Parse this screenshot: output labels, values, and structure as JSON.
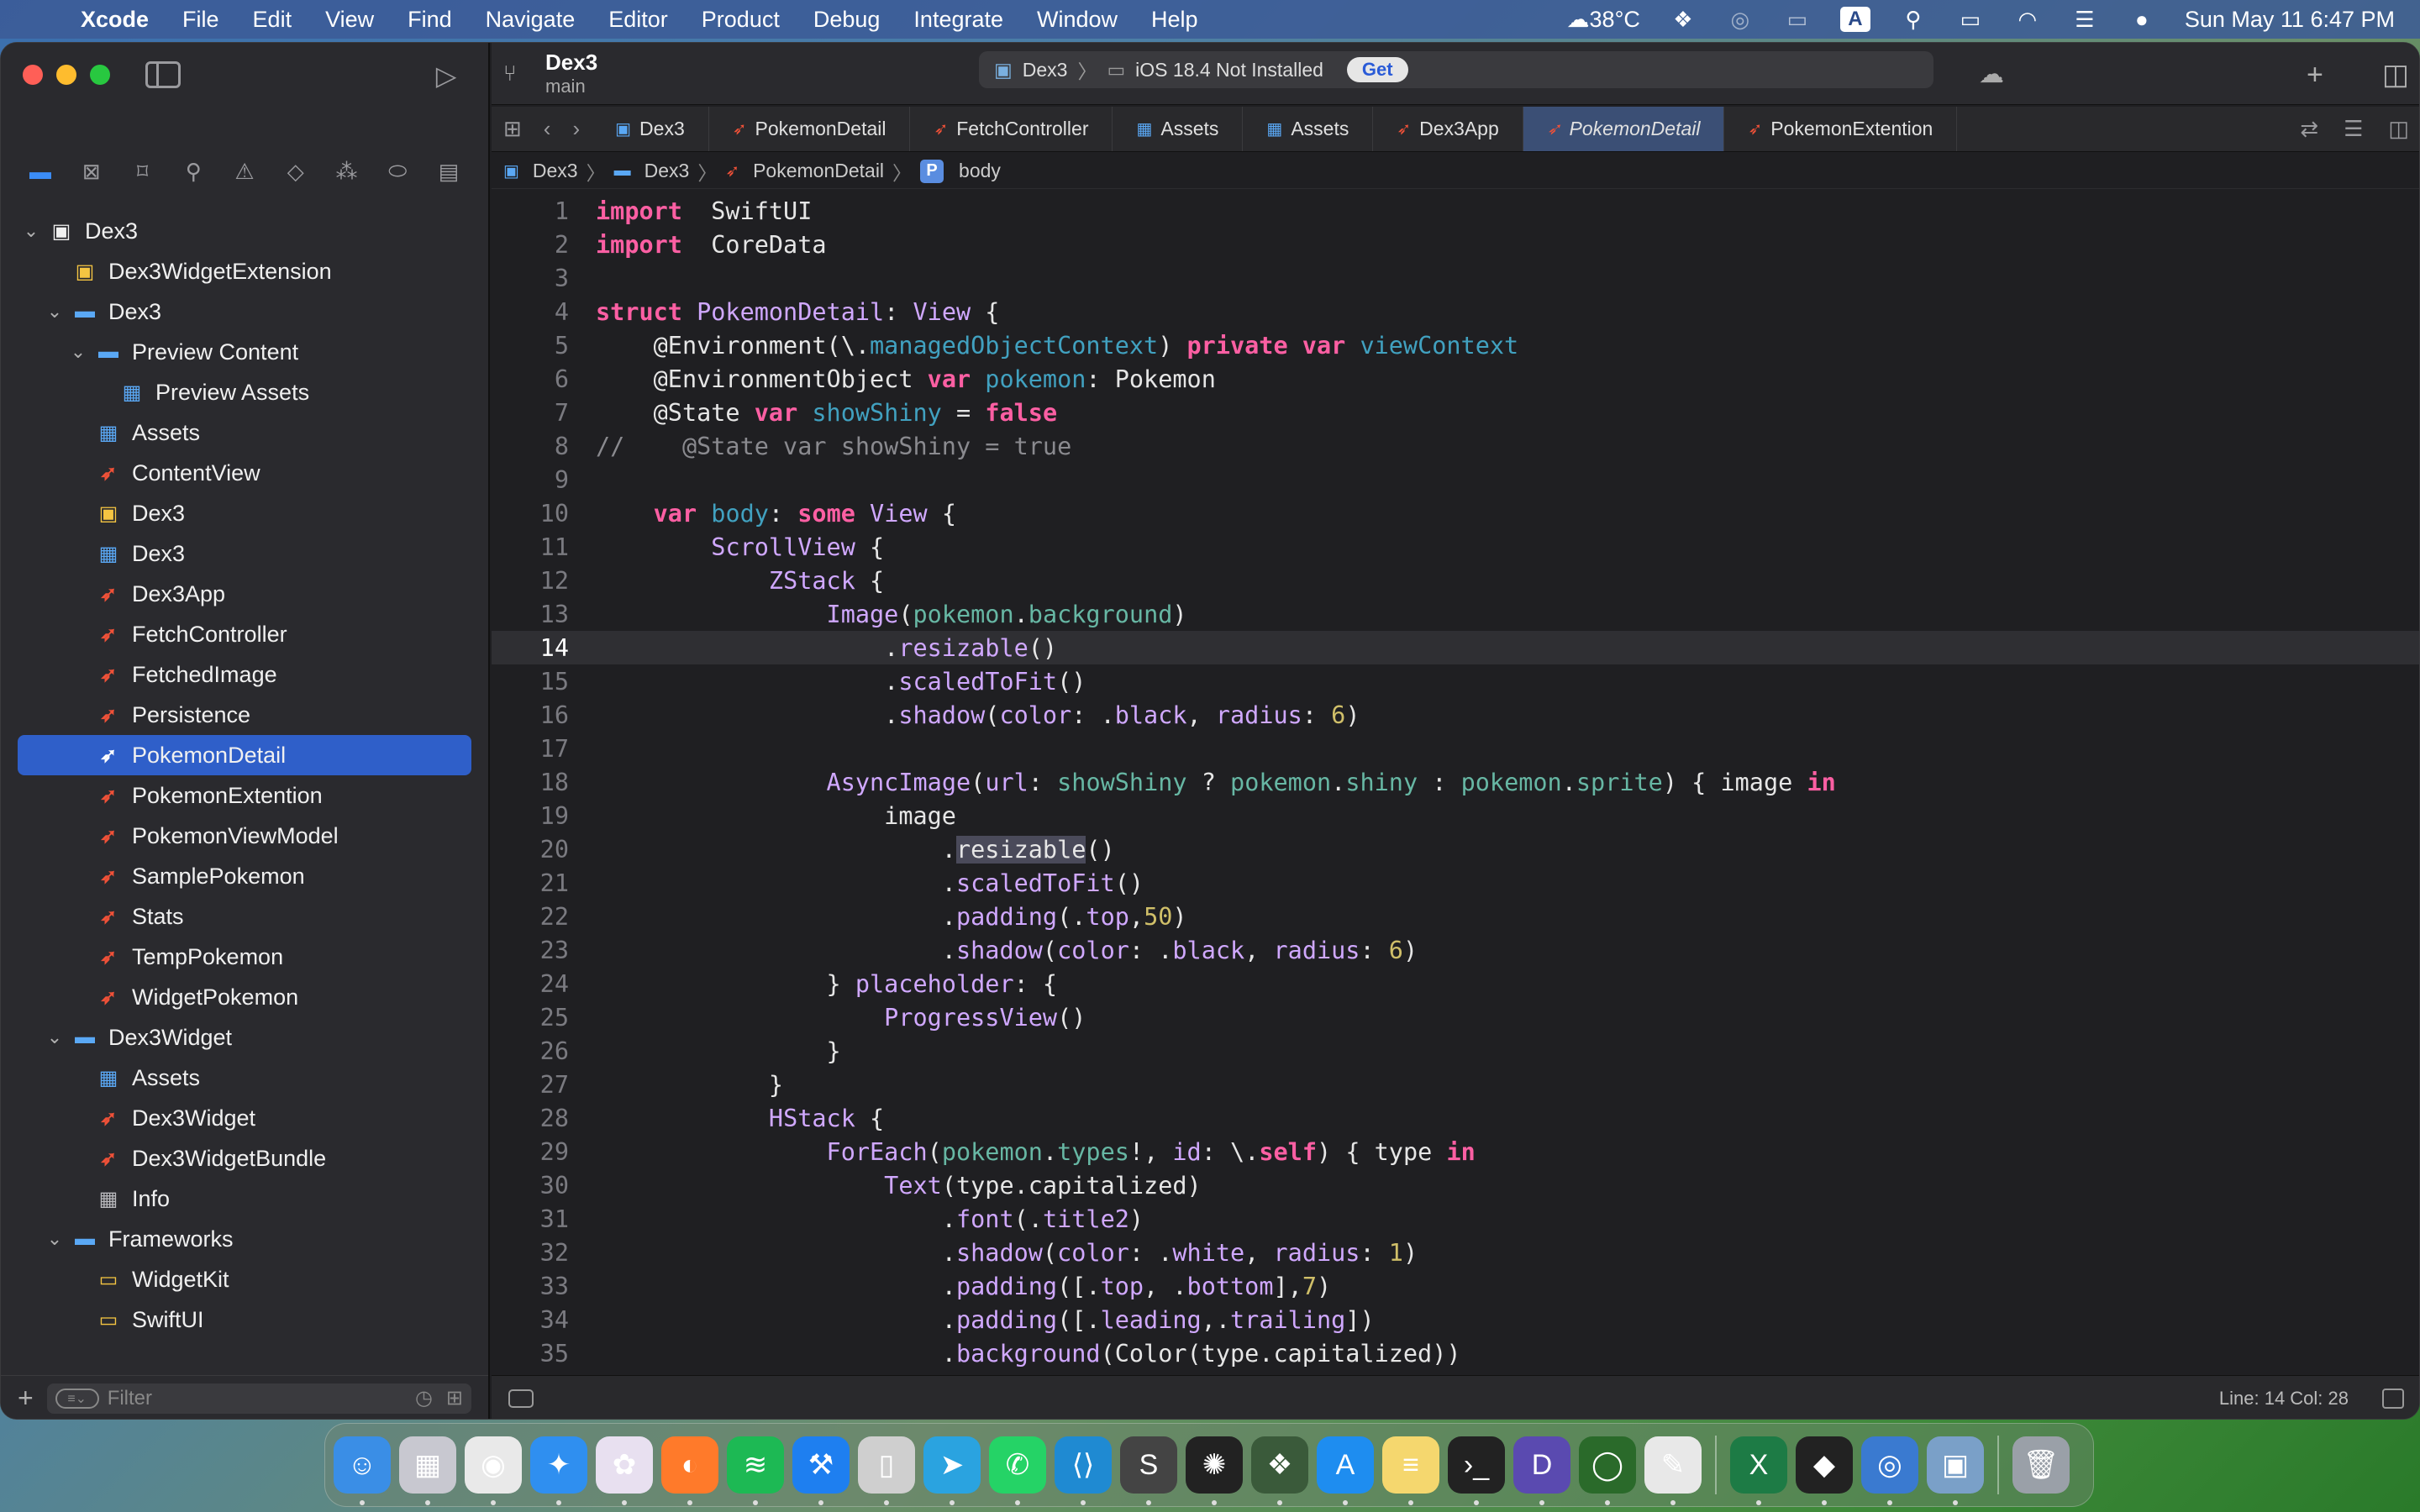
{
  "menubar": {
    "app_name": "Xcode",
    "menus": [
      "File",
      "Edit",
      "View",
      "Find",
      "Navigate",
      "Editor",
      "Product",
      "Debug",
      "Integrate",
      "Window",
      "Help"
    ],
    "temperature": "38°C",
    "input_source": "A",
    "datetime": "Sun May 11  6:47 PM"
  },
  "toolbar": {
    "project_name": "Dex3",
    "branch": "main",
    "scheme": "Dex3",
    "destination": "iOS 18.4 Not Installed",
    "get_label": "Get"
  },
  "tabs": [
    {
      "label": "Dex3",
      "icon": "project-icon",
      "active": false
    },
    {
      "label": "PokemonDetail",
      "icon": "swift-icon",
      "active": false
    },
    {
      "label": "FetchController",
      "icon": "swift-icon",
      "active": false
    },
    {
      "label": "Assets",
      "icon": "assets-icon",
      "active": false
    },
    {
      "label": "Assets",
      "icon": "assets-icon",
      "active": false
    },
    {
      "label": "Dex3App",
      "icon": "swift-icon",
      "active": false
    },
    {
      "label": "PokemonDetail",
      "icon": "swift-icon",
      "active": true
    },
    {
      "label": "PokemonExtention",
      "icon": "swift-icon",
      "active": false
    }
  ],
  "jumpbar": [
    "Dex3",
    "Dex3",
    "PokemonDetail",
    "body"
  ],
  "navigator": [
    {
      "label": "Dex3",
      "depth": 0,
      "chevron": "open",
      "icon": "project"
    },
    {
      "label": "Dex3WidgetExtension",
      "depth": 1,
      "chevron": "",
      "icon": "ext"
    },
    {
      "label": "Dex3",
      "depth": 1,
      "chevron": "open",
      "icon": "folder"
    },
    {
      "label": "Preview Content",
      "depth": 2,
      "chevron": "open",
      "icon": "folder"
    },
    {
      "label": "Preview Assets",
      "depth": 3,
      "chevron": "",
      "icon": "assets"
    },
    {
      "label": "Assets",
      "depth": 2,
      "chevron": "",
      "icon": "assets"
    },
    {
      "label": "ContentView",
      "depth": 2,
      "chevron": "",
      "icon": "swift"
    },
    {
      "label": "Dex3",
      "depth": 2,
      "chevron": "",
      "icon": "ext"
    },
    {
      "label": "Dex3",
      "depth": 2,
      "chevron": "",
      "icon": "assets"
    },
    {
      "label": "Dex3App",
      "depth": 2,
      "chevron": "",
      "icon": "swift"
    },
    {
      "label": "FetchController",
      "depth": 2,
      "chevron": "",
      "icon": "swift"
    },
    {
      "label": "FetchedImage",
      "depth": 2,
      "chevron": "",
      "icon": "swift"
    },
    {
      "label": "Persistence",
      "depth": 2,
      "chevron": "",
      "icon": "swift"
    },
    {
      "label": "PokemonDetail",
      "depth": 2,
      "chevron": "",
      "icon": "swift",
      "selected": true
    },
    {
      "label": "PokemonExtention",
      "depth": 2,
      "chevron": "",
      "icon": "swift"
    },
    {
      "label": "PokemonViewModel",
      "depth": 2,
      "chevron": "",
      "icon": "swift"
    },
    {
      "label": "SamplePokemon",
      "depth": 2,
      "chevron": "",
      "icon": "swift"
    },
    {
      "label": "Stats",
      "depth": 2,
      "chevron": "",
      "icon": "swift"
    },
    {
      "label": "TempPokemon",
      "depth": 2,
      "chevron": "",
      "icon": "swift"
    },
    {
      "label": "WidgetPokemon",
      "depth": 2,
      "chevron": "",
      "icon": "swift"
    },
    {
      "label": "Dex3Widget",
      "depth": 1,
      "chevron": "open",
      "icon": "folder"
    },
    {
      "label": "Assets",
      "depth": 2,
      "chevron": "",
      "icon": "assets"
    },
    {
      "label": "Dex3Widget",
      "depth": 2,
      "chevron": "",
      "icon": "swift"
    },
    {
      "label": "Dex3WidgetBundle",
      "depth": 2,
      "chevron": "",
      "icon": "swift"
    },
    {
      "label": "Info",
      "depth": 2,
      "chevron": "",
      "icon": "info"
    },
    {
      "label": "Frameworks",
      "depth": 1,
      "chevron": "open",
      "icon": "folder"
    },
    {
      "label": "WidgetKit",
      "depth": 2,
      "chevron": "",
      "icon": "fw"
    },
    {
      "label": "SwiftUI",
      "depth": 2,
      "chevron": "",
      "icon": "fw"
    }
  ],
  "filter_placeholder": "Filter",
  "current_line": 14,
  "code_lines": [
    [
      [
        "kw",
        "import"
      ],
      [
        "",
        "  SwiftUI"
      ]
    ],
    [
      [
        "kw",
        "import"
      ],
      [
        "",
        "  CoreData"
      ]
    ],
    [],
    [
      [
        "kw",
        "struct"
      ],
      [
        "",
        ""
      ],
      [
        "ty",
        " PokemonDetail"
      ],
      [
        "",
        ": "
      ],
      [
        "ty",
        "View"
      ],
      [
        "",
        "",
        " {"
      ]
    ],
    [
      [
        "",
        "    @Environment(\\."
      ],
      [
        "prop",
        "managedObjectContext"
      ],
      [
        "",
        ") "
      ],
      [
        "kw",
        "private"
      ],
      [
        "",
        " "
      ],
      [
        "kw",
        "var"
      ],
      [
        "prop",
        " viewContext"
      ]
    ],
    [
      [
        "",
        "    @EnvironmentObject "
      ],
      [
        "kw",
        "var"
      ],
      [
        "prop",
        " pokemon"
      ],
      [
        "",
        ": Pokemon"
      ]
    ],
    [
      [
        "",
        "    @State "
      ],
      [
        "kw",
        "var"
      ],
      [
        "prop",
        " showShiny"
      ],
      [
        "",
        "",
        " = "
      ],
      [
        "kw",
        "false"
      ]
    ],
    [
      [
        "cm",
        "//    @State var showShiny = true"
      ]
    ],
    [],
    [
      [
        "",
        "    "
      ],
      [
        "kw",
        "var"
      ],
      [
        "prop",
        " body"
      ],
      [
        "",
        ": "
      ],
      [
        "kw",
        "some"
      ],
      [
        "ty",
        " View"
      ],
      [
        "",
        " {"
      ]
    ],
    [
      [
        "",
        "        "
      ],
      [
        "ty",
        "ScrollView"
      ],
      [
        "",
        " {"
      ]
    ],
    [
      [
        "",
        "            "
      ],
      [
        "ty",
        "ZStack"
      ],
      [
        "",
        " {"
      ]
    ],
    [
      [
        "",
        "                "
      ],
      [
        "ty",
        "Image"
      ],
      [
        "",
        "("
      ],
      [
        "fn",
        "pokemon"
      ],
      [
        "",
        "."
      ],
      [
        "fn",
        "background"
      ],
      [
        "",
        ")"
      ]
    ],
    [
      [
        "",
        "                    ."
      ],
      [
        "ty",
        "resizable"
      ],
      [
        "",
        "()"
      ]
    ],
    [
      [
        "",
        "                    ."
      ],
      [
        "ty",
        "scaledToFit"
      ],
      [
        "",
        "()"
      ]
    ],
    [
      [
        "",
        "                    ."
      ],
      [
        "ty",
        "shadow"
      ],
      [
        "",
        "("
      ],
      [
        "ty",
        "color"
      ],
      [
        "",
        ": ."
      ],
      [
        "ty",
        "black"
      ],
      [
        "",
        ", "
      ],
      [
        "ty",
        "radius"
      ],
      [
        "",
        ": "
      ],
      [
        "num",
        "6"
      ],
      [
        "",
        ")"
      ]
    ],
    [],
    [
      [
        "",
        "                "
      ],
      [
        "ty",
        "AsyncImage"
      ],
      [
        "",
        "("
      ],
      [
        "ty",
        "url"
      ],
      [
        "",
        ": "
      ],
      [
        "fn",
        "showShiny"
      ],
      [
        "",
        " ? "
      ],
      [
        "fn",
        "pokemon"
      ],
      [
        "",
        "."
      ],
      [
        "fn",
        "shiny"
      ],
      [
        "",
        " : "
      ],
      [
        "fn",
        "pokemon"
      ],
      [
        "",
        "."
      ],
      [
        "fn",
        "sprite"
      ],
      [
        "",
        ") { image "
      ],
      [
        "kw",
        "in"
      ]
    ],
    [
      [
        "",
        "                    image"
      ]
    ],
    [
      [
        "",
        "                        ."
      ],
      [
        "hl",
        "resizable"
      ],
      [
        "",
        "()"
      ]
    ],
    [
      [
        "",
        "                        ."
      ],
      [
        "ty",
        "scaledToFit"
      ],
      [
        "",
        "()"
      ]
    ],
    [
      [
        "",
        "                        ."
      ],
      [
        "ty",
        "padding"
      ],
      [
        "",
        "(."
      ],
      [
        "ty",
        "top"
      ],
      [
        "",
        ","
      ],
      [
        "num",
        "50"
      ],
      [
        "",
        ")"
      ]
    ],
    [
      [
        "",
        "                        ."
      ],
      [
        "ty",
        "shadow"
      ],
      [
        "",
        "("
      ],
      [
        "ty",
        "color"
      ],
      [
        "",
        ": ."
      ],
      [
        "ty",
        "black"
      ],
      [
        "",
        ", "
      ],
      [
        "ty",
        "radius"
      ],
      [
        "",
        ": "
      ],
      [
        "num",
        "6"
      ],
      [
        "",
        ")"
      ]
    ],
    [
      [
        "",
        "                } "
      ],
      [
        "ty",
        "placeholder"
      ],
      [
        "",
        ": {"
      ]
    ],
    [
      [
        "",
        "                    "
      ],
      [
        "ty",
        "ProgressView"
      ],
      [
        "",
        "()"
      ]
    ],
    [
      [
        "",
        "                }"
      ]
    ],
    [
      [
        "",
        "            }"
      ]
    ],
    [
      [
        "",
        "            "
      ],
      [
        "ty",
        "HStack"
      ],
      [
        "",
        " {"
      ]
    ],
    [
      [
        "",
        "                "
      ],
      [
        "ty",
        "ForEach"
      ],
      [
        "",
        "("
      ],
      [
        "fn",
        "pokemon"
      ],
      [
        "",
        "."
      ],
      [
        "fn",
        "types"
      ],
      [
        "",
        "!, "
      ],
      [
        "ty",
        "id"
      ],
      [
        "",
        ": \\."
      ],
      [
        "kw",
        "self"
      ],
      [
        "",
        ") { type "
      ],
      [
        "kw",
        "in"
      ]
    ],
    [
      [
        "",
        "                    "
      ],
      [
        "ty",
        "Text"
      ],
      [
        "",
        "(type.capitalized)"
      ]
    ],
    [
      [
        "",
        "                        ."
      ],
      [
        "ty",
        "font"
      ],
      [
        "",
        "(."
      ],
      [
        "ty",
        "title2"
      ],
      [
        "",
        ")"
      ]
    ],
    [
      [
        "",
        "                        ."
      ],
      [
        "ty",
        "shadow"
      ],
      [
        "",
        "("
      ],
      [
        "ty",
        "color"
      ],
      [
        "",
        ": ."
      ],
      [
        "ty",
        "white"
      ],
      [
        "",
        ", "
      ],
      [
        "ty",
        "radius"
      ],
      [
        "",
        ": "
      ],
      [
        "num",
        "1"
      ],
      [
        "",
        ")"
      ]
    ],
    [
      [
        "",
        "                        ."
      ],
      [
        "ty",
        "padding"
      ],
      [
        "",
        "([."
      ],
      [
        "ty",
        "top"
      ],
      [
        "",
        ", ."
      ],
      [
        "ty",
        "bottom"
      ],
      [
        "",
        "],"
      ],
      [
        "num",
        "7"
      ],
      [
        "",
        ")"
      ]
    ],
    [
      [
        "",
        "                        ."
      ],
      [
        "ty",
        "padding"
      ],
      [
        "",
        "([."
      ],
      [
        "ty",
        "leading"
      ],
      [
        "",
        ",."
      ],
      [
        "ty",
        "trailing"
      ],
      [
        "",
        "])"
      ]
    ],
    [
      [
        "",
        "                        ."
      ],
      [
        "ty",
        "background"
      ],
      [
        "",
        "(Color(type.capitalized))"
      ]
    ]
  ],
  "status": {
    "position": "Line: 14  Col: 28"
  },
  "dock_apps": [
    {
      "name": "finder",
      "color": "#3a8ee6",
      "glyph": "☺"
    },
    {
      "name": "launchpad",
      "color": "#c8c8d0",
      "glyph": "▦"
    },
    {
      "name": "chrome",
      "color": "#e9e9e9",
      "glyph": "◉"
    },
    {
      "name": "safari",
      "color": "#2f8ff0",
      "glyph": "✦"
    },
    {
      "name": "photos-app",
      "color": "#e8e0f0",
      "glyph": "✿"
    },
    {
      "name": "firefox",
      "color": "#ff7a2a",
      "glyph": "◐"
    },
    {
      "name": "spotify",
      "color": "#1db954",
      "glyph": "≋"
    },
    {
      "name": "xcode",
      "color": "#1e7ff0",
      "glyph": "⚒"
    },
    {
      "name": "simulator",
      "color": "#cfcfcf",
      "glyph": "▯"
    },
    {
      "name": "telegram",
      "color": "#2aa3e0",
      "glyph": "➤"
    },
    {
      "name": "whatsapp",
      "color": "#25d366",
      "glyph": "✆"
    },
    {
      "name": "vscode",
      "color": "#1f8ad2",
      "glyph": "⟨⟩"
    },
    {
      "name": "sublime",
      "color": "#444",
      "glyph": "S"
    },
    {
      "name": "chatgpt",
      "color": "#222",
      "glyph": "✺"
    },
    {
      "name": "app-icon",
      "color": "#3a5a3a",
      "glyph": "❖"
    },
    {
      "name": "app-store",
      "color": "#1e8df0",
      "glyph": "A"
    },
    {
      "name": "notes",
      "color": "#f5d76e",
      "glyph": "≡"
    },
    {
      "name": "terminal",
      "color": "#222",
      "glyph": "›_"
    },
    {
      "name": "dash-app",
      "color": "#5a4ab0",
      "glyph": "D"
    },
    {
      "name": "refresh-app",
      "color": "#2a6a2a",
      "glyph": "◯"
    },
    {
      "name": "textedit",
      "color": "#e8e8e8",
      "glyph": "✎"
    },
    {
      "name": "excel",
      "color": "#1d7b45",
      "glyph": "X"
    },
    {
      "name": "unity-app",
      "color": "#222",
      "glyph": "◆"
    },
    {
      "name": "preview-app",
      "color": "#3a7ad0",
      "glyph": "◎"
    },
    {
      "name": "screenshot-app",
      "color": "#7aa0c8",
      "glyph": "▣"
    },
    {
      "name": "trash",
      "color": "#9aa0a8",
      "glyph": "🗑"
    }
  ]
}
